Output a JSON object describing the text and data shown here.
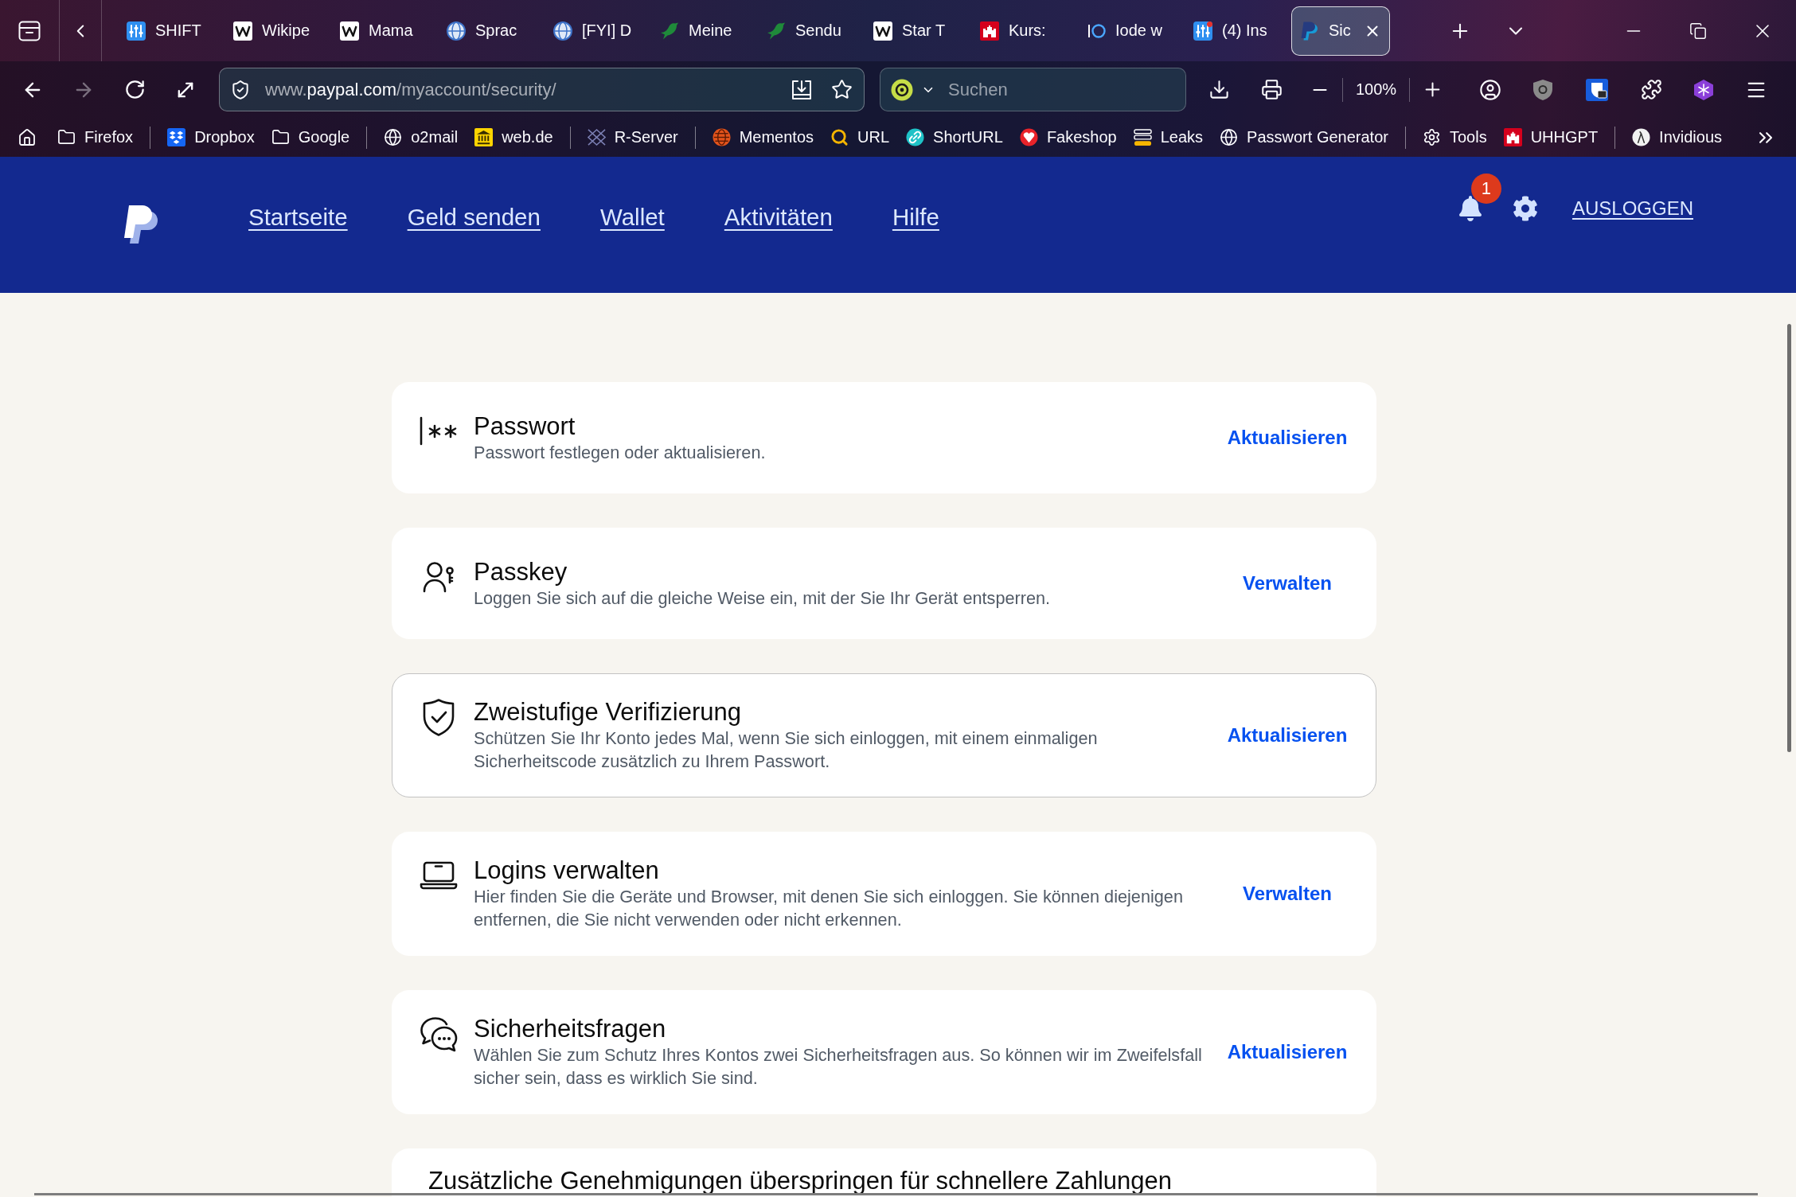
{
  "tab_strip": {
    "tabs": [
      {
        "label": "SHIFT",
        "kind": "sliders",
        "attention": false,
        "selected": false
      },
      {
        "label": "Wikipe",
        "kind": "wletter",
        "attention": false,
        "selected": false
      },
      {
        "label": "Mama",
        "kind": "wletter",
        "attention": false,
        "selected": false
      },
      {
        "label": "Sprac",
        "kind": "globe",
        "attention": false,
        "selected": false
      },
      {
        "label": "[FYI] D",
        "kind": "globe",
        "attention": false,
        "selected": false
      },
      {
        "label": "Meine",
        "kind": "bird",
        "attention": false,
        "selected": false
      },
      {
        "label": "Sendu",
        "kind": "bird",
        "attention": false,
        "selected": false
      },
      {
        "label": "Star T",
        "kind": "wletter",
        "attention": false,
        "selected": false
      },
      {
        "label": "Kurs:",
        "kind": "castle",
        "attention": false,
        "selected": false
      },
      {
        "label": "Iode w",
        "kind": "ring",
        "attention": false,
        "selected": false
      },
      {
        "label": "(4) Ins",
        "kind": "sliders",
        "attention": true,
        "selected": false
      },
      {
        "label": "Sic",
        "kind": "pletter",
        "attention": false,
        "selected": true
      }
    ]
  },
  "toolbar": {
    "back": {
      "disabled": false
    },
    "forward": {
      "disabled": true
    },
    "url": {
      "prefix": "www.",
      "domain": "paypal.com",
      "path": "/myaccount/security/"
    },
    "search": {
      "placeholder": "Suchen"
    },
    "zoom": "100%"
  },
  "bookmarks": {
    "groups": [
      {
        "items": [
          {
            "label": "Firefox",
            "kind": "folder"
          }
        ]
      },
      {
        "items": [
          {
            "label": "Dropbox",
            "kind": "box"
          },
          {
            "label": "Google",
            "kind": "folder"
          }
        ]
      },
      {
        "items": [
          {
            "label": "o2mail",
            "kind": "globe"
          },
          {
            "label": "web.de",
            "kind": "bank"
          }
        ]
      },
      {
        "items": [
          {
            "label": "R-Server",
            "kind": "lattice"
          }
        ]
      },
      {
        "items": [
          {
            "label": "Mementos",
            "kind": "badge"
          },
          {
            "label": "URL",
            "kind": "magnifier"
          },
          {
            "label": "ShortURL",
            "kind": "link"
          },
          {
            "label": "Fakeshop",
            "kind": "heart"
          },
          {
            "label": "Leaks",
            "kind": "stack"
          },
          {
            "label": "Passwort Generator",
            "kind": "globe"
          }
        ]
      },
      {
        "items": [
          {
            "label": "Tools",
            "kind": "gear"
          },
          {
            "label": "UHHGPT",
            "kind": "castle"
          }
        ]
      },
      {
        "items": [
          {
            "label": "Invidious",
            "kind": "disc"
          }
        ]
      }
    ]
  },
  "header": {
    "nav": [
      "Startseite",
      "Geld senden",
      "Wallet",
      "Aktivitäten",
      "Hilfe"
    ],
    "notification_count": "1",
    "logout": "AUSLOGGEN"
  },
  "security_items": [
    {
      "kind": "password",
      "title": "Passwort",
      "description": "Passwort festlegen oder aktualisieren.",
      "action": "Aktualisieren",
      "highlighted": false
    },
    {
      "kind": "passkey",
      "title": "Passkey",
      "description": "Loggen Sie sich auf die gleiche Weise ein, mit der Sie Ihr Gerät entsperren.",
      "action": "Verwalten",
      "highlighted": false
    },
    {
      "kind": "verification",
      "title": "Zweistufige Verifizierung",
      "description": "Schützen Sie Ihr Konto jedes Mal, wenn Sie sich einloggen, mit einem einmaligen Sicherheitscode zusätzlich zu Ihrem Passwort.",
      "action": "Aktualisieren",
      "highlighted": true
    },
    {
      "kind": "devices",
      "title": "Logins verwalten",
      "description": "Hier finden Sie die Geräte und Browser, mit denen Sie sich einloggen. Sie können diejenigen entfernen, die Sie nicht verwenden oder nicht erkennen.",
      "action": "Verwalten",
      "highlighted": false
    },
    {
      "kind": "questions",
      "title": "Sicherheitsfragen",
      "description": "Wählen Sie zum Schutz Ihres Kontos zwei Sicherheitsfragen aus. So können wir im Zweifelsfall sicher sein, dass es wirklich Sie sind.",
      "action": "Aktualisieren",
      "highlighted": false
    },
    {
      "kind": "plain",
      "title": "Zusätzliche Genehmigungen überspringen für schnellere Zahlungen",
      "highlighted": false
    }
  ]
}
